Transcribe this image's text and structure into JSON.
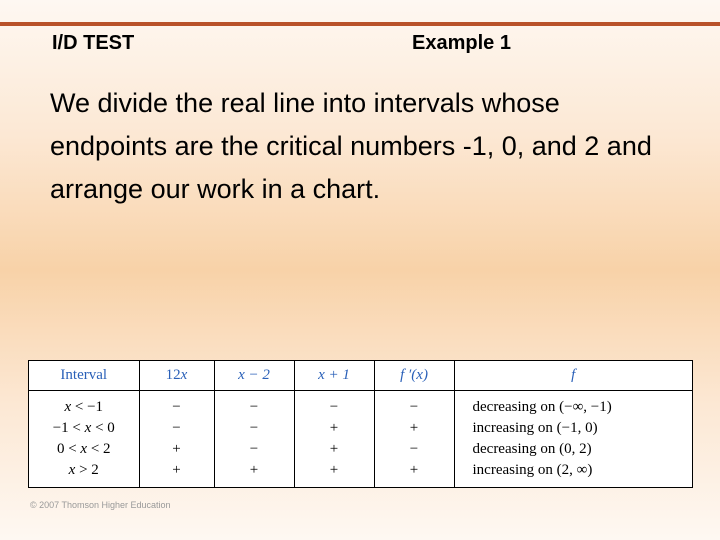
{
  "header": {
    "left": "I/D TEST",
    "right": "Example 1"
  },
  "body": {
    "text": "We divide the real line into intervals whose endpoints are the critical numbers -1, 0, and 2 and arrange our work in a chart."
  },
  "chart_data": {
    "type": "table",
    "headers": {
      "interval": "Interval",
      "f1": "12x",
      "f2": "x − 2",
      "f3": "x + 1",
      "fp": "f ′(x)",
      "f": "f"
    },
    "rows": [
      {
        "interval": "x < −1",
        "f1": "−",
        "f2": "−",
        "f3": "−",
        "fp": "−",
        "desc": "decreasing on (−∞, −1)"
      },
      {
        "interval": "−1 < x < 0",
        "f1": "−",
        "f2": "−",
        "f3": "+",
        "fp": "+",
        "desc": "increasing on (−1, 0)"
      },
      {
        "interval": "0 < x < 2",
        "f1": "+",
        "f2": "−",
        "f3": "+",
        "fp": "−",
        "desc": "decreasing on (0, 2)"
      },
      {
        "interval": "x > 2",
        "f1": "+",
        "f2": "+",
        "f3": "+",
        "fp": "+",
        "desc": "increasing on (2, ∞)"
      }
    ]
  },
  "footer": {
    "copyright": "© 2007 Thomson Higher Education"
  }
}
